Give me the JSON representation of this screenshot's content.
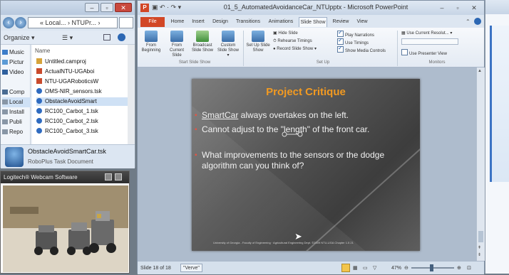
{
  "explorer": {
    "address": "« Local... › NTUPr... ›",
    "toolbar": {
      "organize": "Organize ▾",
      "views": "☰ ▾"
    },
    "nav_items": [
      "Music",
      "Pictur",
      "Video",
      "Comp",
      "Local",
      "Install",
      "Publi",
      "Repo"
    ],
    "column_name": "Name",
    "files": [
      "Untitled.camproj",
      "ActualNTU-UGAboi",
      "NTU-UGARoboticsW",
      "OMS-NIR_sensors.tsk",
      "ObstacleAvoidSmart",
      "RC100_Carbot_1.tsk",
      "RC100_Carbot_2.tsk",
      "RC100_Carbot_3.tsk"
    ],
    "details": {
      "name": "ObstacleAvoidSmartCar.tsk",
      "type": "RoboPlus Task Document"
    }
  },
  "webcam": {
    "title": "Logitech® Webcam Software"
  },
  "ppt": {
    "title": "01_5_AutomatedAvoidanceCar_NTUpptx - Microsoft PowerPoint",
    "qat": "▣ ↶ · ↷ ▾",
    "tabs": [
      "File",
      "Home",
      "Insert",
      "Design",
      "Transitions",
      "Animations",
      "Slide Show",
      "Review",
      "View"
    ],
    "ribbon": {
      "start": {
        "from_beginning": "From Beginning",
        "from_current": "From Current Slide",
        "broadcast": "Broadcast Slide Show",
        "custom": "Custom Slide Show ▾",
        "label": "Start Slide Show"
      },
      "setup": {
        "setup": "Set Up Slide Show",
        "hide": "Hide Slide",
        "rehearse": "Rehearse Timings",
        "record": "Record Slide Show ▾",
        "play_narrations": "Play Narrations",
        "use_timings": "Use Timings",
        "show_media": "Show Media Controls",
        "label": "Set Up"
      },
      "monitors": {
        "resolution": "Use Current Resolut... ▾",
        "show_on": "",
        "presenter_view": "Use Presenter View",
        "label": "Monitors"
      }
    },
    "slide": {
      "title": "Project Critique",
      "bullet1_link": "SmartCar",
      "bullet1_rest": " always overtakes on the left.",
      "bullet2": "Cannot adjust to the \"length\" of the front car.",
      "bullet3": "What improvements to the sensors or the dodge algorithm can you think of?",
      "footer": "University of Georgia - Faculty of Engineering · Agricultural Engineering Dept.        ©2009 NTU-UGA Chapter 1.5        21"
    },
    "status": {
      "slide": "Slide 18 of 18",
      "theme": "\"Verve\"",
      "zoom": "47%"
    }
  },
  "colors": {
    "accent_orange": "#f29a21",
    "bullet_red": "#e04a3a",
    "file_tab": "#d24726"
  }
}
